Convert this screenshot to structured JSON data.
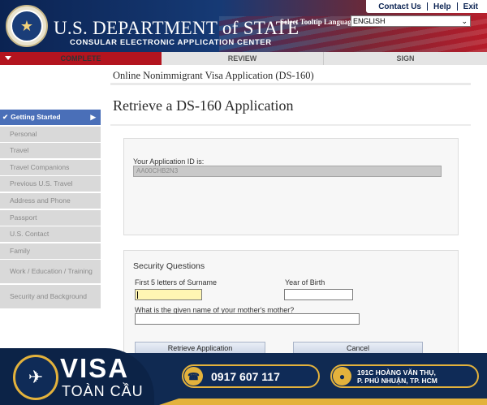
{
  "header": {
    "dept_title": "U.S. DEPARTMENT of STATE",
    "dept_subtitle": "CONSULAR ELECTRONIC APPLICATION CENTER",
    "links": {
      "contact": "Contact Us",
      "help": "Help",
      "exit": "Exit"
    },
    "language_label": "Select Tooltip Language",
    "language_value": "ENGLISH"
  },
  "progress": {
    "complete": "COMPLETE",
    "review": "REVIEW",
    "sign": "SIGN"
  },
  "form_title": "Online Nonimmigrant Visa Application (DS-160)",
  "page_title": "Retrieve a DS-160 Application",
  "sidebar": {
    "items": [
      {
        "label": "Getting Started"
      },
      {
        "label": "Personal"
      },
      {
        "label": "Travel"
      },
      {
        "label": "Travel Companions"
      },
      {
        "label": "Previous U.S. Travel"
      },
      {
        "label": "Address and Phone"
      },
      {
        "label": "Passport"
      },
      {
        "label": "U.S. Contact"
      },
      {
        "label": "Family"
      },
      {
        "label": "Work / Education / Training"
      },
      {
        "label": "Security and Background"
      }
    ]
  },
  "app_id": {
    "label": "Your Application ID is:",
    "value": "AA00CHB2N3"
  },
  "security": {
    "title": "Security Questions",
    "surname_label": "First 5 letters of Surname",
    "surname_value": "",
    "year_label": "Year of Birth",
    "year_value": "",
    "mother_label": "What is the given name of your mother's mother?",
    "mother_value": ""
  },
  "buttons": {
    "retrieve": "Retrieve Application",
    "cancel": "Cancel"
  },
  "ad": {
    "brand_main": "VISA",
    "brand_sub": "TOÀN CẦU",
    "phone": "0917 607 117",
    "address_line1": "191C HOÀNG VĂN THỤ,",
    "address_line2": "P. PHÚ NHUẬN, TP. HCM"
  },
  "colors": {
    "navy": "#0b2352",
    "red": "#b3141f",
    "active_nav": "#4a6fb8",
    "gold": "#e3b23c"
  }
}
